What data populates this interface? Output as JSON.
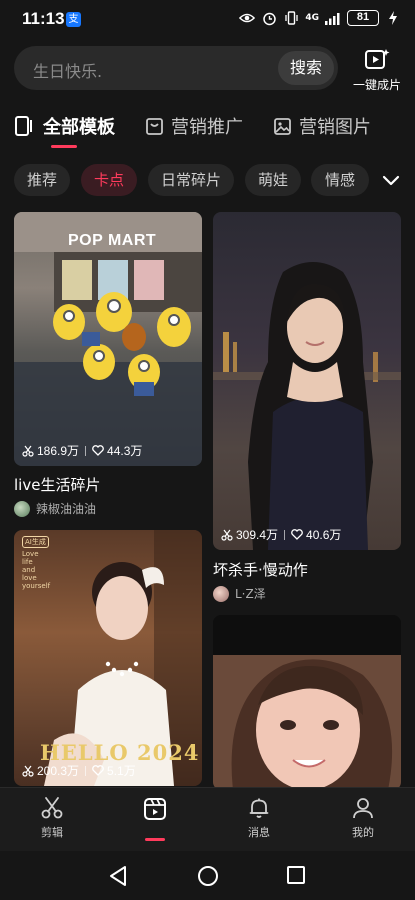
{
  "status_bar": {
    "time": "11:13",
    "alipay": "支",
    "network": "4G",
    "battery": "81"
  },
  "search": {
    "placeholder": "生日快乐.",
    "button_label": "搜索"
  },
  "oneclick": {
    "label": "一键成片"
  },
  "category_tabs": [
    {
      "label": "全部模板",
      "icon": "template-icon",
      "active": true
    },
    {
      "label": "营销推广",
      "icon": "bag-icon",
      "active": false
    },
    {
      "label": "营销图片",
      "icon": "image-icon",
      "active": false
    }
  ],
  "chips": [
    {
      "label": "推荐",
      "active": false
    },
    {
      "label": "卡点",
      "active": true
    },
    {
      "label": "日常碎片",
      "active": false
    },
    {
      "label": "萌娃",
      "active": false
    },
    {
      "label": "情感",
      "active": false
    }
  ],
  "feed": {
    "cards": [
      {
        "title": "live生活碎片",
        "author": "辣椒油油油",
        "uses": "186.9万",
        "likes": "44.3万",
        "image_text": "POP MART"
      },
      {
        "title": "坏杀手·慢动作",
        "author": "L·Z泽",
        "uses": "309.4万",
        "likes": "40.6万"
      },
      {
        "title": "",
        "author": "",
        "uses": "200.3万",
        "likes": "5.1万",
        "image_text": "HELLO 2024",
        "tag": "AI生成",
        "side_text": [
          "Love",
          "life",
          "and",
          "love",
          "yourself"
        ]
      },
      {
        "title": "",
        "author": "",
        "uses": "",
        "likes": ""
      }
    ]
  },
  "bottom_nav": [
    {
      "label": "剪辑",
      "icon": "scissors-icon",
      "active": false
    },
    {
      "label": "",
      "icon": "template-clapper-icon",
      "active": true
    },
    {
      "label": "消息",
      "icon": "bell-icon",
      "active": false
    },
    {
      "label": "我的",
      "icon": "user-icon",
      "active": false
    }
  ],
  "colors": {
    "accent": "#ff3b5c",
    "background": "#161616",
    "surface": "#2a2a2a"
  }
}
